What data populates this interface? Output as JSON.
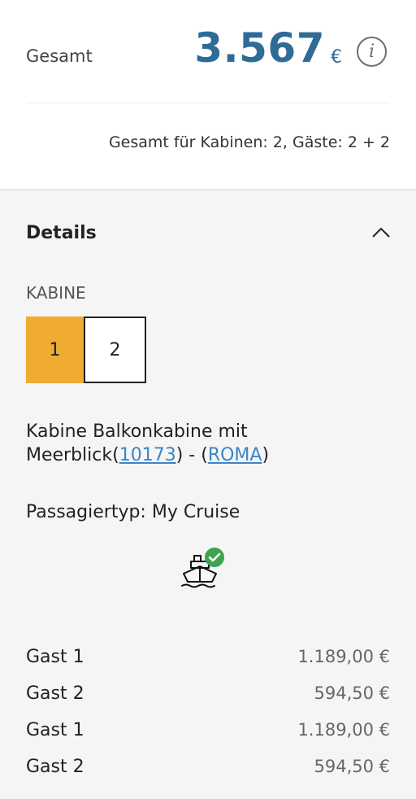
{
  "summary": {
    "total_label": "Gesamt",
    "total_amount": "3.567",
    "currency": "€",
    "info_glyph": "i",
    "breakdown": "Gesamt für Kabinen: 2, Gäste: 2 + 2"
  },
  "details": {
    "title": "Details",
    "kabine_label": "KABINE",
    "cabins": [
      "1",
      "2"
    ],
    "active_cabin": "1",
    "cabin_text_prefix": "Kabine Balkonkabine mit Meerblick(",
    "cabin_number": "10173",
    "cabin_text_middle": ") - (",
    "ship_name": "ROMA",
    "cabin_text_suffix": ")",
    "passenger_type": "Passagiertyp: My Cruise",
    "icon": "cruise-ship-check-icon"
  },
  "prices": [
    {
      "name": "Gast 1",
      "value": "1.189,00 €"
    },
    {
      "name": "Gast 2",
      "value": "594,50 €"
    },
    {
      "name": "Gast 1",
      "value": "1.189,00 €"
    },
    {
      "name": "Gast 2",
      "value": "594,50 €"
    }
  ],
  "colors": {
    "accent": "#f0ab32",
    "price_blue": "#2f6b97",
    "link": "#3a85c8",
    "check_green": "#3fa24f"
  }
}
